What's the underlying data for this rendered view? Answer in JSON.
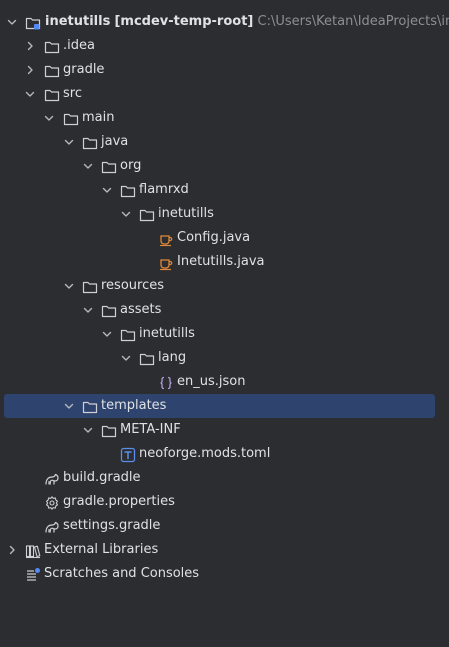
{
  "tree": {
    "rows": [
      {
        "label": "inetutills",
        "module": "[mcdev-temp-root]",
        "path": "C:\\Users\\Ketan\\IdeaProjects\\inetutills",
        "icon": "module-folder-icon",
        "expanded": true
      },
      {
        "label": ".idea",
        "icon": "folder-icon",
        "expanded": false
      },
      {
        "label": "gradle",
        "icon": "folder-icon",
        "expanded": false
      },
      {
        "label": "src",
        "icon": "folder-icon",
        "expanded": true
      },
      {
        "label": "main",
        "icon": "folder-icon",
        "expanded": true
      },
      {
        "label": "java",
        "icon": "folder-icon",
        "expanded": true
      },
      {
        "label": "org",
        "icon": "folder-icon",
        "expanded": true
      },
      {
        "label": "flamrxd",
        "icon": "folder-icon",
        "expanded": true
      },
      {
        "label": "inetutills",
        "icon": "folder-icon",
        "expanded": true
      },
      {
        "label": "Config.java",
        "icon": "java-file-icon"
      },
      {
        "label": "Inetutills.java",
        "icon": "java-file-icon"
      },
      {
        "label": "resources",
        "icon": "folder-icon",
        "expanded": true
      },
      {
        "label": "assets",
        "icon": "folder-icon",
        "expanded": true
      },
      {
        "label": "inetutills",
        "icon": "folder-icon",
        "expanded": true
      },
      {
        "label": "lang",
        "icon": "folder-icon",
        "expanded": true
      },
      {
        "label": "en_us.json",
        "icon": "json-file-icon"
      },
      {
        "label": "templates",
        "icon": "folder-icon",
        "expanded": true,
        "selected": true
      },
      {
        "label": "META-INF",
        "icon": "folder-icon",
        "expanded": true
      },
      {
        "label": "neoforge.mods.toml",
        "icon": "toml-file-icon"
      },
      {
        "label": "build.gradle",
        "icon": "gradle-icon"
      },
      {
        "label": "gradle.properties",
        "icon": "gear-icon"
      },
      {
        "label": "settings.gradle",
        "icon": "gradle-icon"
      },
      {
        "label": "External Libraries",
        "icon": "libraries-icon",
        "expanded": false
      },
      {
        "label": "Scratches and Consoles",
        "icon": "scratches-icon"
      }
    ]
  },
  "colors": {
    "background": "#2b2d30",
    "text": "#dfe1e5",
    "muted": "#8c8f94",
    "selection": "#2e436e",
    "java_orange": "#e0883a",
    "json_purple": "#b39ddb",
    "toml_blue": "#5a8ee8"
  }
}
